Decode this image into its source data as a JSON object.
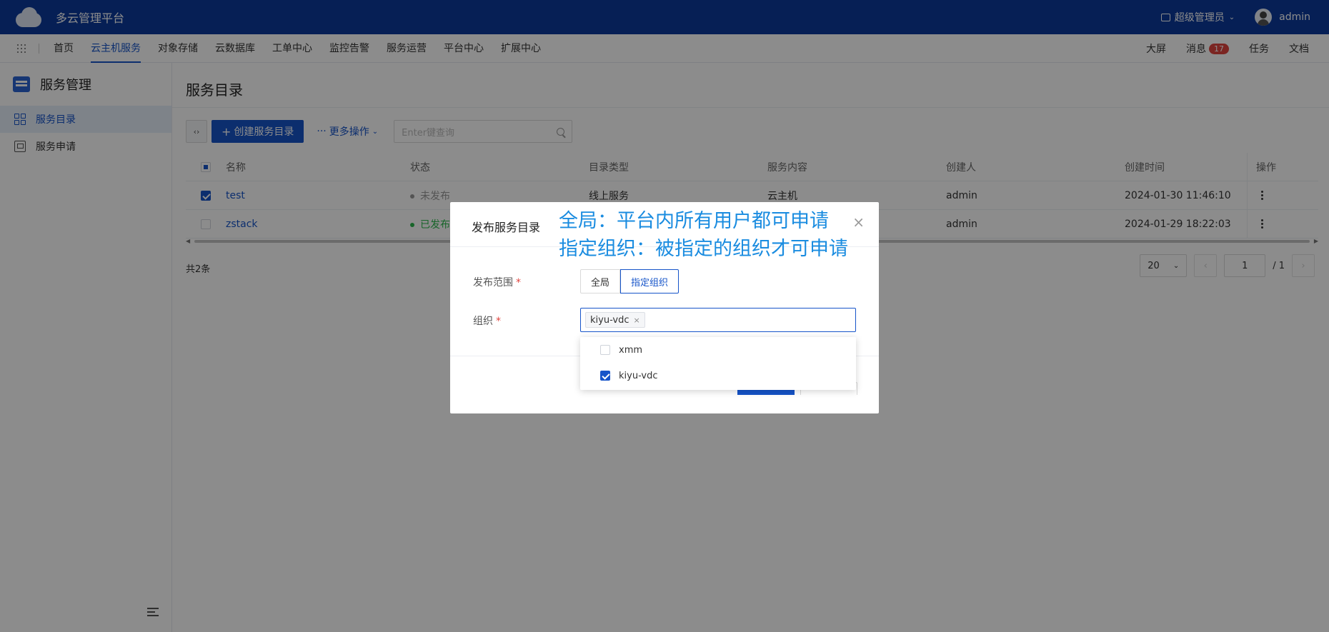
{
  "topbar": {
    "app_title": "多云管理平台",
    "role": "超级管理员",
    "user": "admin"
  },
  "nav": {
    "items": [
      "首页",
      "云主机服务",
      "对象存储",
      "云数据库",
      "工单中心",
      "监控告警",
      "服务运营",
      "平台中心",
      "扩展中心"
    ],
    "active_index": 1,
    "right": {
      "bigscreen": "大屏",
      "messages": "消息",
      "message_count": "17",
      "tasks": "任务",
      "docs": "文档"
    }
  },
  "sidebar": {
    "title": "服务管理",
    "items": [
      "服务目录",
      "服务申请"
    ]
  },
  "page": {
    "title": "服务目录",
    "create_button": "创建服务目录",
    "more_button": "更多操作",
    "search_placeholder": "Enter键查询",
    "table": {
      "headers": [
        "名称",
        "状态",
        "目录类型",
        "服务内容",
        "创建人",
        "创建时间",
        "操作"
      ],
      "rows": [
        {
          "name": "test",
          "status": "未发布",
          "type": "线上服务",
          "content": "云主机",
          "creator": "admin",
          "created": "2024-01-30 11:46:10",
          "checked": true,
          "status_color": "#999999"
        },
        {
          "name": "zstack",
          "status": "已发布",
          "type": "",
          "content": "",
          "creator": "admin",
          "created": "2024-01-29 18:22:03",
          "checked": false,
          "status_color": "#2db84d"
        }
      ]
    },
    "total": "共2条",
    "pager": {
      "page_size": "20",
      "current_page": "1",
      "total_pages": "/ 1"
    }
  },
  "modal": {
    "title": "发布服务目录",
    "scope_label": "发布范围",
    "scope_options": [
      "全局",
      "指定组织"
    ],
    "scope_selected": "指定组织",
    "org_label": "组织",
    "org_tags": [
      "kiyu-vdc"
    ],
    "org_options": [
      {
        "label": "xmm",
        "checked": false
      },
      {
        "label": "kiyu-vdc",
        "checked": true
      }
    ]
  },
  "annotation": {
    "line1": "全局：平台内所有用户都可申请",
    "line2": "指定组织：被指定的组织才可申请"
  },
  "colors": {
    "primary": "#1654c9",
    "topbar": "#0c3a9c",
    "annotation": "#1a8ce0",
    "badge": "#e0443e"
  }
}
